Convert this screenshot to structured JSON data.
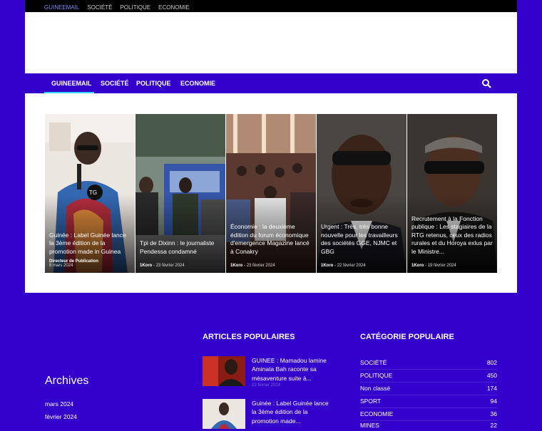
{
  "topbar": {
    "links": [
      "GUINEEMAIL",
      "SOCIÉTÉ",
      "POLITIQUE",
      "ECONOMIE"
    ]
  },
  "navbar": {
    "items": [
      "GUINEEMAIL",
      "SOCIÉTÉ",
      "POLITIQUE",
      "ECONOMIE"
    ],
    "search_icon": "search-icon"
  },
  "featured": [
    {
      "title": "Guinée : Label Guinée lance la 3ème édition de la promotion made in Guinea",
      "author": "Directeur de Publication",
      "date": "8 mars 2024"
    },
    {
      "title": "Tpi de Dixinn : le journaliste Pendessa condamné",
      "author": "1Koro",
      "date": "23 février 2024"
    },
    {
      "title": "Économie : la deuxième édition du forum économique d'emergence Magazine lancé à Conakry",
      "author": "1Koro",
      "date": "23 février 2024"
    },
    {
      "title": "Urgent : Très, très bonne nouvelle pour les travailleurs des sociétés GGE, NJMC et GBG",
      "author": "1Koro",
      "date": "22 février 2024"
    },
    {
      "title": "Recrutement à la Fonction publique : Les stagiaires de la RTG retenus, ceux des radios rurales et du Horoya exlus par le Ministre...",
      "author": "1Koro",
      "date": "19 février 2024"
    }
  ],
  "footer": {
    "archives_title": "Archives",
    "archives": [
      "mars 2024",
      "février 2024"
    ],
    "popular_title": "ARTICLES POPULAIRES",
    "popular": [
      {
        "title": "GUINEE : Mamadou lamine Aminata Bah raconte sa mésaventure suite à...",
        "date": "23 février 2024"
      },
      {
        "title": "Guinée : Label Guinée lance la 3ème édition de la promotion made...",
        "date": ""
      }
    ],
    "categories_title": "CATÉGORIE POPULAIRE",
    "categories": [
      {
        "name": "SOCIÉTÉ",
        "count": "802"
      },
      {
        "name": "POLITIQUE",
        "count": "450"
      },
      {
        "name": "Non classé",
        "count": "174"
      },
      {
        "name": "SPORT",
        "count": "94"
      },
      {
        "name": "ECONOMIE",
        "count": "36"
      },
      {
        "name": "MINES",
        "count": "22"
      }
    ]
  },
  "colors": {
    "brand": "#3300cc",
    "accent": "#3ad0ff"
  }
}
